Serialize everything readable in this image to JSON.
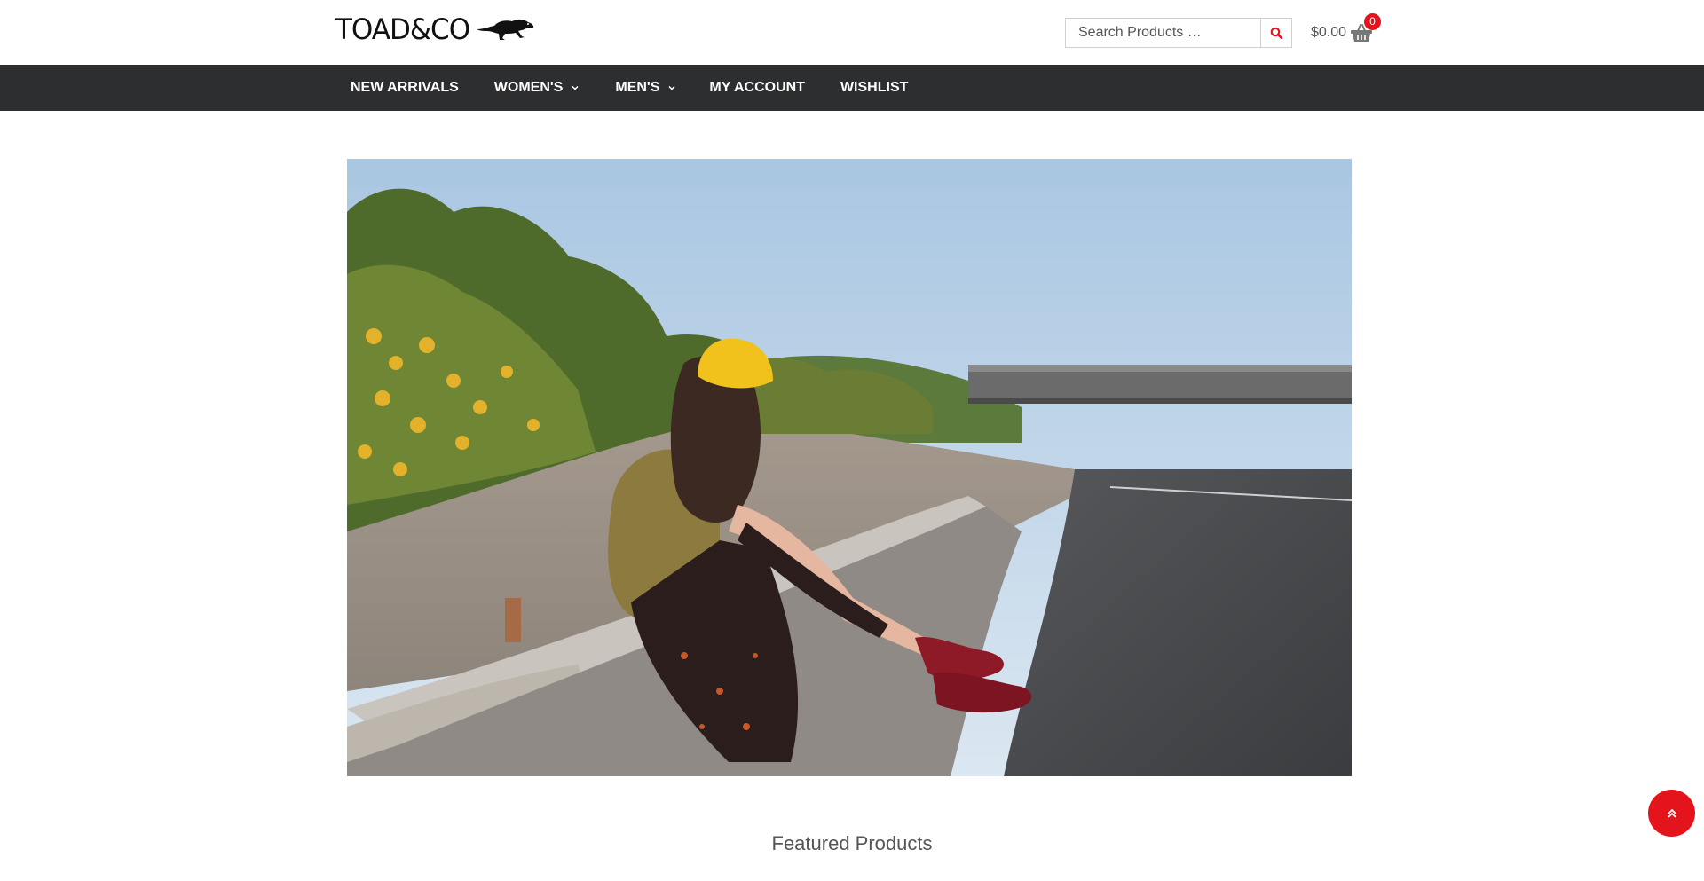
{
  "brand": {
    "logo_text": "TOAD&CO"
  },
  "search": {
    "placeholder": "Search Products …"
  },
  "cart": {
    "total": "$0.00",
    "count": "0"
  },
  "nav": {
    "items": [
      {
        "label": "NEW ARRIVALS",
        "has_dropdown": false
      },
      {
        "label": "WOMEN'S",
        "has_dropdown": true
      },
      {
        "label": "MEN'S",
        "has_dropdown": true
      },
      {
        "label": "MY ACCOUNT",
        "has_dropdown": false
      },
      {
        "label": "WISHLIST",
        "has_dropdown": false
      }
    ]
  },
  "main": {
    "section_title": "Featured Products"
  },
  "icons": {
    "search": "search-icon",
    "cart": "shopping-basket-icon",
    "dropdown": "chevron-down-icon",
    "scroll_top": "double-chevron-up-icon"
  },
  "colors": {
    "accent": "#e3141b",
    "nav_bg": "#2d2e30",
    "text_muted": "#555555"
  }
}
